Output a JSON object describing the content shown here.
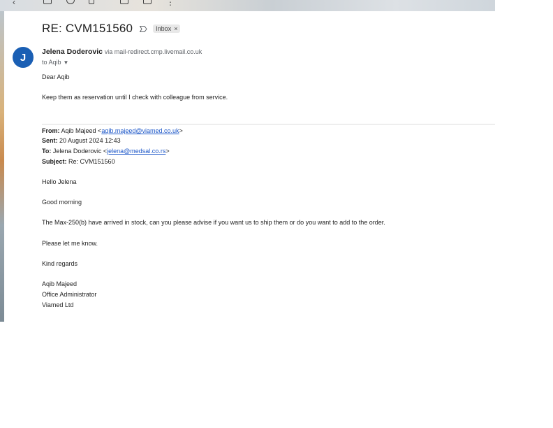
{
  "email": {
    "subject": "RE: CVM151560",
    "label_badge": "Inbox",
    "label_remove": "×",
    "avatar_initial": "J",
    "sender_name": "Jelena Doderovic",
    "sender_via": "via mail-redirect.cmp.livemail.co.uk",
    "recipient": "to Aqib",
    "greeting": "Dear Aqib",
    "reply_body": "Keep them as reservation until I check with colleague from service."
  },
  "quoted": {
    "from_label": "From:",
    "from_name": "Aqib Majeed <",
    "from_email": "aqib.majeed@viamed.co.uk",
    "from_close": ">",
    "sent_label": "Sent:",
    "sent_value": "20 August 2024 12:43",
    "to_label": "To:",
    "to_name": "Jelena Doderovic <",
    "to_email": "jelena@medsal.co.rs",
    "to_close": ">",
    "subject_label": "Subject:",
    "subject_value": "Re: CVM151560",
    "hello": "Hello Jelena",
    "good_morning": "Good morning",
    "body": "The Max-250(b) have arrived in stock, can you please advise if you want us to ship them or do you want to add to the order.",
    "please": "Please let me know.",
    "regards": "Kind regards",
    "sig_name": "Aqib Majeed",
    "sig_title": "Office Administrator",
    "sig_company": "Viamed Ltd"
  }
}
